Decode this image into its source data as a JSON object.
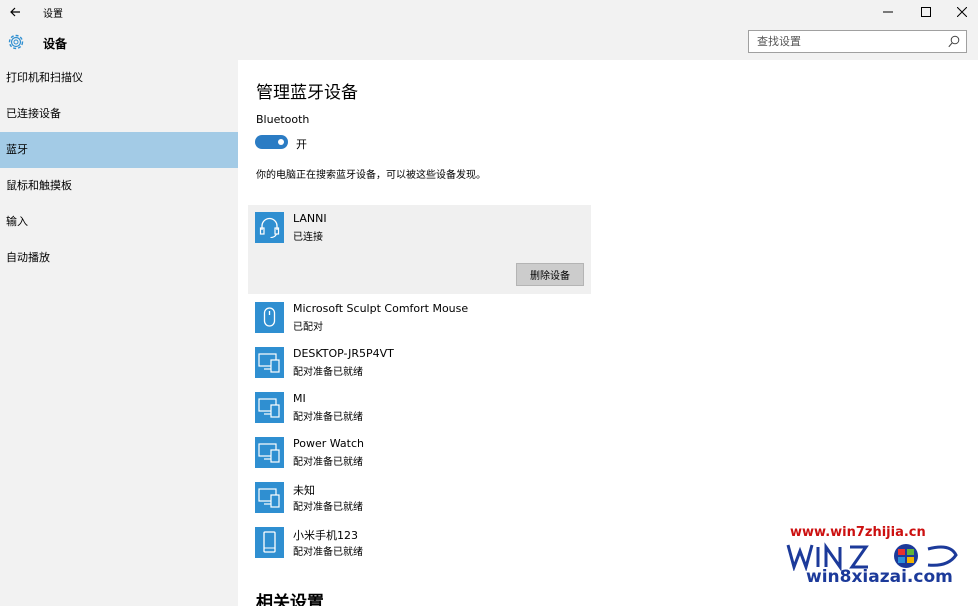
{
  "window": {
    "title": "设置"
  },
  "header": {
    "title": "设备",
    "search_placeholder": "查找设置"
  },
  "sidebar": {
    "items": [
      {
        "label": "打印机和扫描仪",
        "selected": false
      },
      {
        "label": "已连接设备",
        "selected": false
      },
      {
        "label": "蓝牙",
        "selected": true
      },
      {
        "label": "鼠标和触摸板",
        "selected": false
      },
      {
        "label": "输入",
        "selected": false
      },
      {
        "label": "自动播放",
        "selected": false
      }
    ]
  },
  "main": {
    "title": "管理蓝牙设备",
    "bluetooth_label": "Bluetooth",
    "toggle_state": "开",
    "toggle_on": true,
    "description": "你的电脑正在搜索蓝牙设备，可以被这些设备发现。",
    "remove_button": "删除设备",
    "devices": [
      {
        "name": "LANNI",
        "status": "已连接",
        "icon": "headset-icon"
      },
      {
        "name": "Microsoft Sculpt Comfort Mouse",
        "status": "已配对",
        "icon": "mouse-icon"
      },
      {
        "name": "DESKTOP-JR5P4VT",
        "status": "配对准备已就绪",
        "icon": "computer-phone-icon"
      },
      {
        "name": "MI",
        "status": "配对准备已就绪",
        "icon": "computer-phone-icon"
      },
      {
        "name": "Power Watch",
        "status": "配对准备已就绪",
        "icon": "computer-phone-icon"
      },
      {
        "name": "未知",
        "status": "配对准备已就绪",
        "icon": "computer-phone-icon"
      },
      {
        "name": "小米手机123",
        "status": "配对准备已就绪",
        "icon": "phone-icon"
      }
    ],
    "related_title": "相关设置"
  },
  "watermark": {
    "top_url": "www.win7zhijia.cn",
    "bottom_url": "win8xiazai.com"
  },
  "colors": {
    "accent": "#2f8fd1",
    "toggle": "#2b7cc4",
    "selected_nav": "#a3cbe6",
    "chrome": "#f2f2f2"
  }
}
